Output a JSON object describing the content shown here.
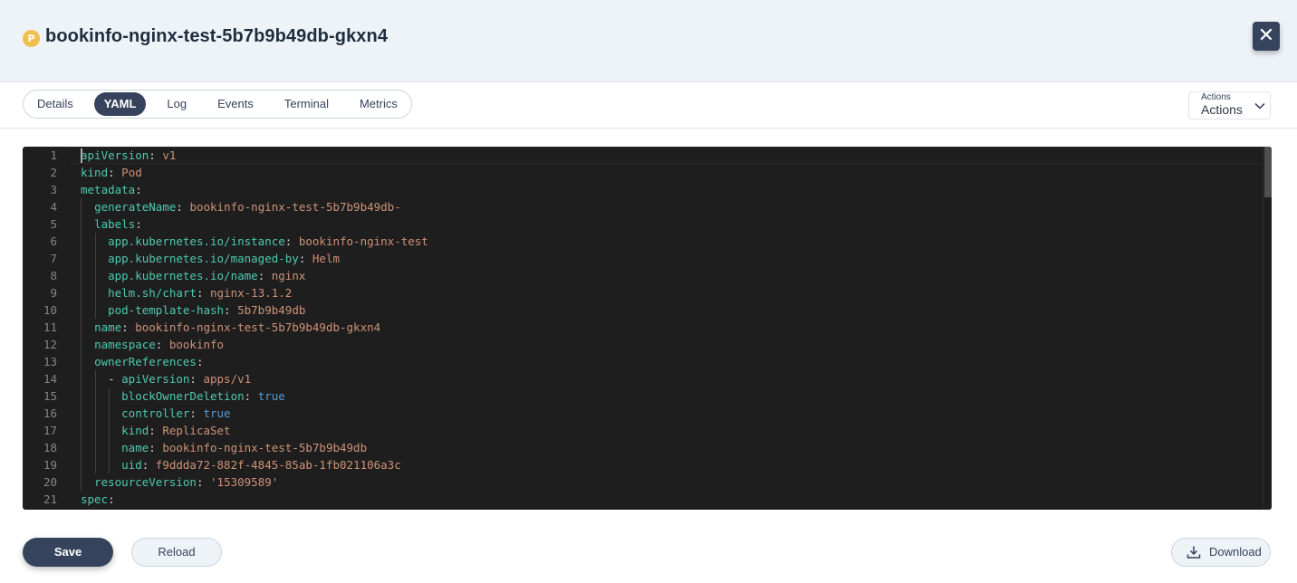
{
  "header": {
    "pod_icon_letter": "P",
    "title": "bookinfo-nginx-test-5b7b9b49db-gkxn4",
    "close_icon": "close-icon",
    "close_glyph": "✕"
  },
  "tabs": [
    {
      "label": "Details",
      "active": false
    },
    {
      "label": "YAML",
      "active": true
    },
    {
      "label": "Log",
      "active": false
    },
    {
      "label": "Events",
      "active": false
    },
    {
      "label": "Terminal",
      "active": false
    },
    {
      "label": "Metrics",
      "active": false
    }
  ],
  "actions": {
    "small_label": "Actions",
    "label": "Actions",
    "icon": "chevron-down-icon"
  },
  "editor": {
    "lines": [
      [
        [
          "k",
          "apiVersion"
        ],
        [
          "p",
          ": "
        ],
        [
          "s",
          "v1"
        ]
      ],
      [
        [
          "k",
          "kind"
        ],
        [
          "p",
          ": "
        ],
        [
          "s",
          "Pod"
        ]
      ],
      [
        [
          "k",
          "metadata"
        ],
        [
          "p",
          ":"
        ]
      ],
      [
        [
          "p",
          "  "
        ],
        [
          "k",
          "generateName"
        ],
        [
          "p",
          ": "
        ],
        [
          "s",
          "bookinfo-nginx-test-5b7b9b49db-"
        ]
      ],
      [
        [
          "p",
          "  "
        ],
        [
          "k",
          "labels"
        ],
        [
          "p",
          ":"
        ]
      ],
      [
        [
          "p",
          "    "
        ],
        [
          "k",
          "app.kubernetes.io/instance"
        ],
        [
          "p",
          ": "
        ],
        [
          "s",
          "bookinfo-nginx-test"
        ]
      ],
      [
        [
          "p",
          "    "
        ],
        [
          "k",
          "app.kubernetes.io/managed-by"
        ],
        [
          "p",
          ": "
        ],
        [
          "s",
          "Helm"
        ]
      ],
      [
        [
          "p",
          "    "
        ],
        [
          "k",
          "app.kubernetes.io/name"
        ],
        [
          "p",
          ": "
        ],
        [
          "s",
          "nginx"
        ]
      ],
      [
        [
          "p",
          "    "
        ],
        [
          "k",
          "helm.sh/chart"
        ],
        [
          "p",
          ": "
        ],
        [
          "s",
          "nginx-13.1.2"
        ]
      ],
      [
        [
          "p",
          "    "
        ],
        [
          "k",
          "pod-template-hash"
        ],
        [
          "p",
          ": "
        ],
        [
          "s",
          "5b7b9b49db"
        ]
      ],
      [
        [
          "p",
          "  "
        ],
        [
          "k",
          "name"
        ],
        [
          "p",
          ": "
        ],
        [
          "s",
          "bookinfo-nginx-test-5b7b9b49db-gkxn4"
        ]
      ],
      [
        [
          "p",
          "  "
        ],
        [
          "k",
          "namespace"
        ],
        [
          "p",
          ": "
        ],
        [
          "s",
          "bookinfo"
        ]
      ],
      [
        [
          "p",
          "  "
        ],
        [
          "k",
          "ownerReferences"
        ],
        [
          "p",
          ":"
        ]
      ],
      [
        [
          "p",
          "    - "
        ],
        [
          "k",
          "apiVersion"
        ],
        [
          "p",
          ": "
        ],
        [
          "s",
          "apps/v1"
        ]
      ],
      [
        [
          "p",
          "      "
        ],
        [
          "k",
          "blockOwnerDeletion"
        ],
        [
          "p",
          ": "
        ],
        [
          "b",
          "true"
        ]
      ],
      [
        [
          "p",
          "      "
        ],
        [
          "k",
          "controller"
        ],
        [
          "p",
          ": "
        ],
        [
          "b",
          "true"
        ]
      ],
      [
        [
          "p",
          "      "
        ],
        [
          "k",
          "kind"
        ],
        [
          "p",
          ": "
        ],
        [
          "s",
          "ReplicaSet"
        ]
      ],
      [
        [
          "p",
          "      "
        ],
        [
          "k",
          "name"
        ],
        [
          "p",
          ": "
        ],
        [
          "s",
          "bookinfo-nginx-test-5b7b9b49db"
        ]
      ],
      [
        [
          "p",
          "      "
        ],
        [
          "k",
          "uid"
        ],
        [
          "p",
          ": "
        ],
        [
          "s",
          "f9ddda72-882f-4845-85ab-1fb021106a3c"
        ]
      ],
      [
        [
          "p",
          "  "
        ],
        [
          "k",
          "resourceVersion"
        ],
        [
          "p",
          ": "
        ],
        [
          "s",
          "'15309589'"
        ]
      ],
      [
        [
          "k",
          "spec"
        ],
        [
          "p",
          ":"
        ]
      ]
    ]
  },
  "footer": {
    "save_label": "Save",
    "reload_label": "Reload",
    "download_label": "Download",
    "download_icon": "download-icon"
  }
}
